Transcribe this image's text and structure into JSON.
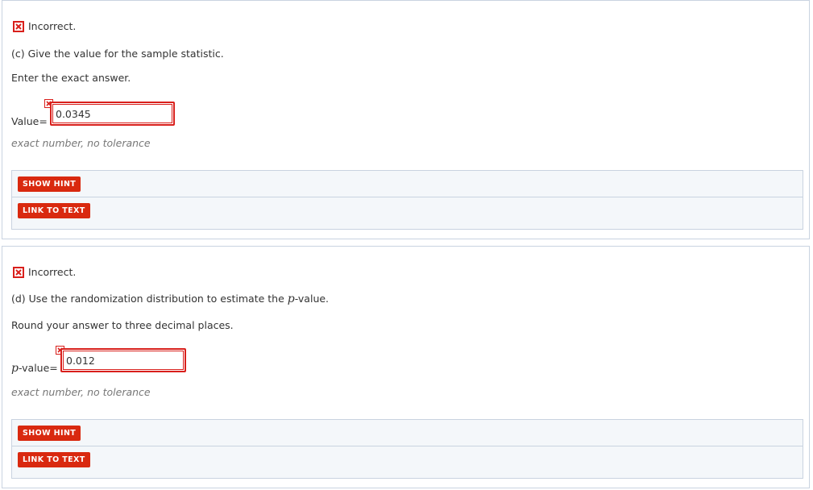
{
  "part_c": {
    "status": "Incorrect.",
    "question": "(c) Give the value for the sample statistic.",
    "instruction": "Enter the exact answer.",
    "answer_label": "Value=",
    "answer_value": "0.0345",
    "tolerance": "exact number, no tolerance",
    "hint_button": "SHOW HINT",
    "link_button": "LINK TO TEXT"
  },
  "part_d": {
    "status": "Incorrect.",
    "question_before": "(d) Use the randomization distribution to estimate the ",
    "question_var": "p",
    "question_after": "-value.",
    "instruction": "Round your answer to three decimal places.",
    "answer_var": "p",
    "answer_label": "-value=",
    "answer_value": "0.012",
    "tolerance": "exact number, no tolerance",
    "hint_button": "SHOW HINT",
    "link_button": "LINK TO TEXT"
  },
  "colors": {
    "error": "#d9201c",
    "button": "#d9290f",
    "panel_border": "#c9d3e0",
    "hint_bg": "#f4f7fa"
  }
}
